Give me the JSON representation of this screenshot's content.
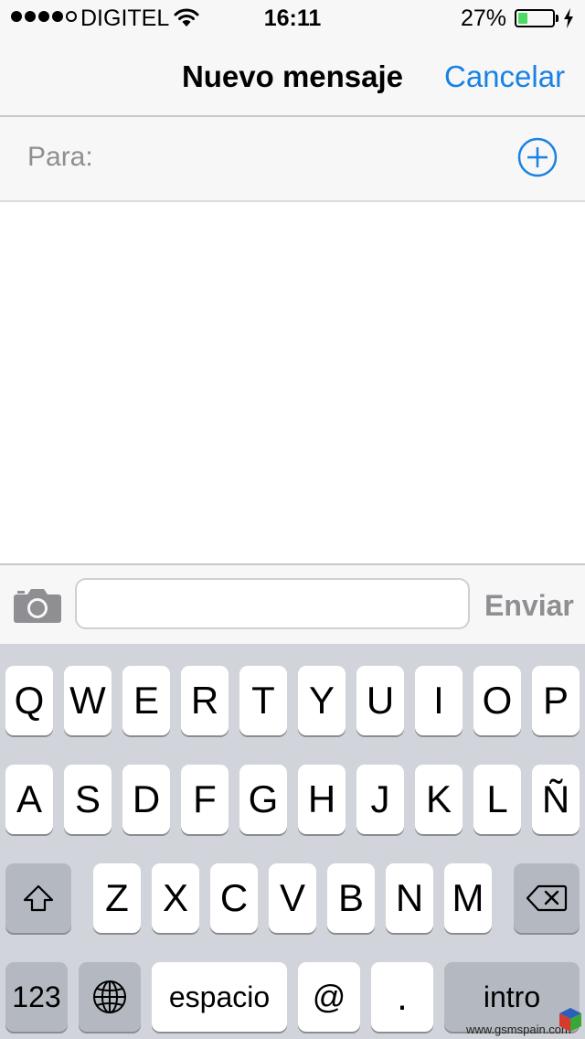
{
  "status_bar": {
    "signal": {
      "filled": 4,
      "total": 5
    },
    "carrier": "DIGITEL",
    "time": "16:11",
    "battery_percent_text": "27%",
    "battery_level": 0.27,
    "charging_icon": "bolt-icon"
  },
  "nav": {
    "title": "Nuevo mensaje",
    "cancel_label": "Cancelar"
  },
  "to_field": {
    "label": "Para:",
    "add_icon": "plus-circle-icon"
  },
  "compose": {
    "camera_icon": "camera-icon",
    "input_value": "",
    "send_label": "Enviar"
  },
  "keyboard": {
    "row1": [
      "Q",
      "W",
      "E",
      "R",
      "T",
      "Y",
      "U",
      "I",
      "O",
      "P"
    ],
    "row2": [
      "A",
      "S",
      "D",
      "F",
      "G",
      "H",
      "J",
      "K",
      "L",
      "Ñ"
    ],
    "row3": [
      "Z",
      "X",
      "C",
      "V",
      "B",
      "N",
      "M"
    ],
    "shift_icon": "shift-icon",
    "delete_icon": "delete-icon",
    "numbers_label": "123",
    "globe_icon": "globe-icon",
    "space_label": "espacio",
    "at_label": "@",
    "dot_label": ".",
    "return_label": "intro"
  },
  "watermark": {
    "text": "www.gsmspain.com"
  },
  "colors": {
    "accent": "#1a82e2",
    "battery_fill": "#4cd964",
    "keyboard_bg": "#d1d5db",
    "bar_bg": "#f7f7f7"
  }
}
